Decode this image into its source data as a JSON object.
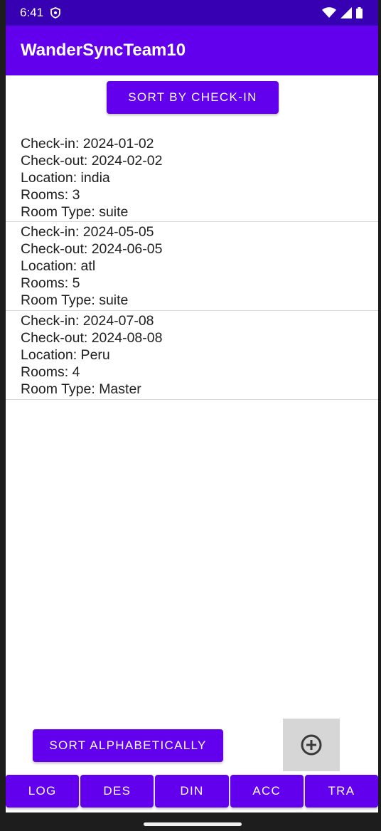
{
  "status_bar": {
    "time": "6:41"
  },
  "app_bar": {
    "title": "WanderSyncTeam10"
  },
  "sort_checkin_label": "SORT BY CHECK-IN",
  "reservations": [
    {
      "checkin": "Check-in: 2024-01-02",
      "checkout": "Check-out: 2024-02-02",
      "location": "Location: india",
      "rooms": "Rooms: 3",
      "room_type": "Room Type: suite"
    },
    {
      "checkin": "Check-in: 2024-05-05",
      "checkout": "Check-out: 2024-06-05",
      "location": "Location: atl",
      "rooms": "Rooms: 5",
      "room_type": "Room Type: suite"
    },
    {
      "checkin": "Check-in: 2024-07-08",
      "checkout": "Check-out: 2024-08-08",
      "location": "Location: Peru",
      "rooms": "Rooms: 4",
      "room_type": "Room Type: Master"
    }
  ],
  "sort_alpha_label": "SORT ALPHABETICALLY",
  "fab": {
    "icon": "add-circle-icon"
  },
  "nav": {
    "log": "LOG",
    "des": "DES",
    "din": "DIN",
    "acc": "ACC",
    "tra": "TRA"
  },
  "colors": {
    "primary": "#6200ee",
    "status_bar": "#3700b3"
  }
}
